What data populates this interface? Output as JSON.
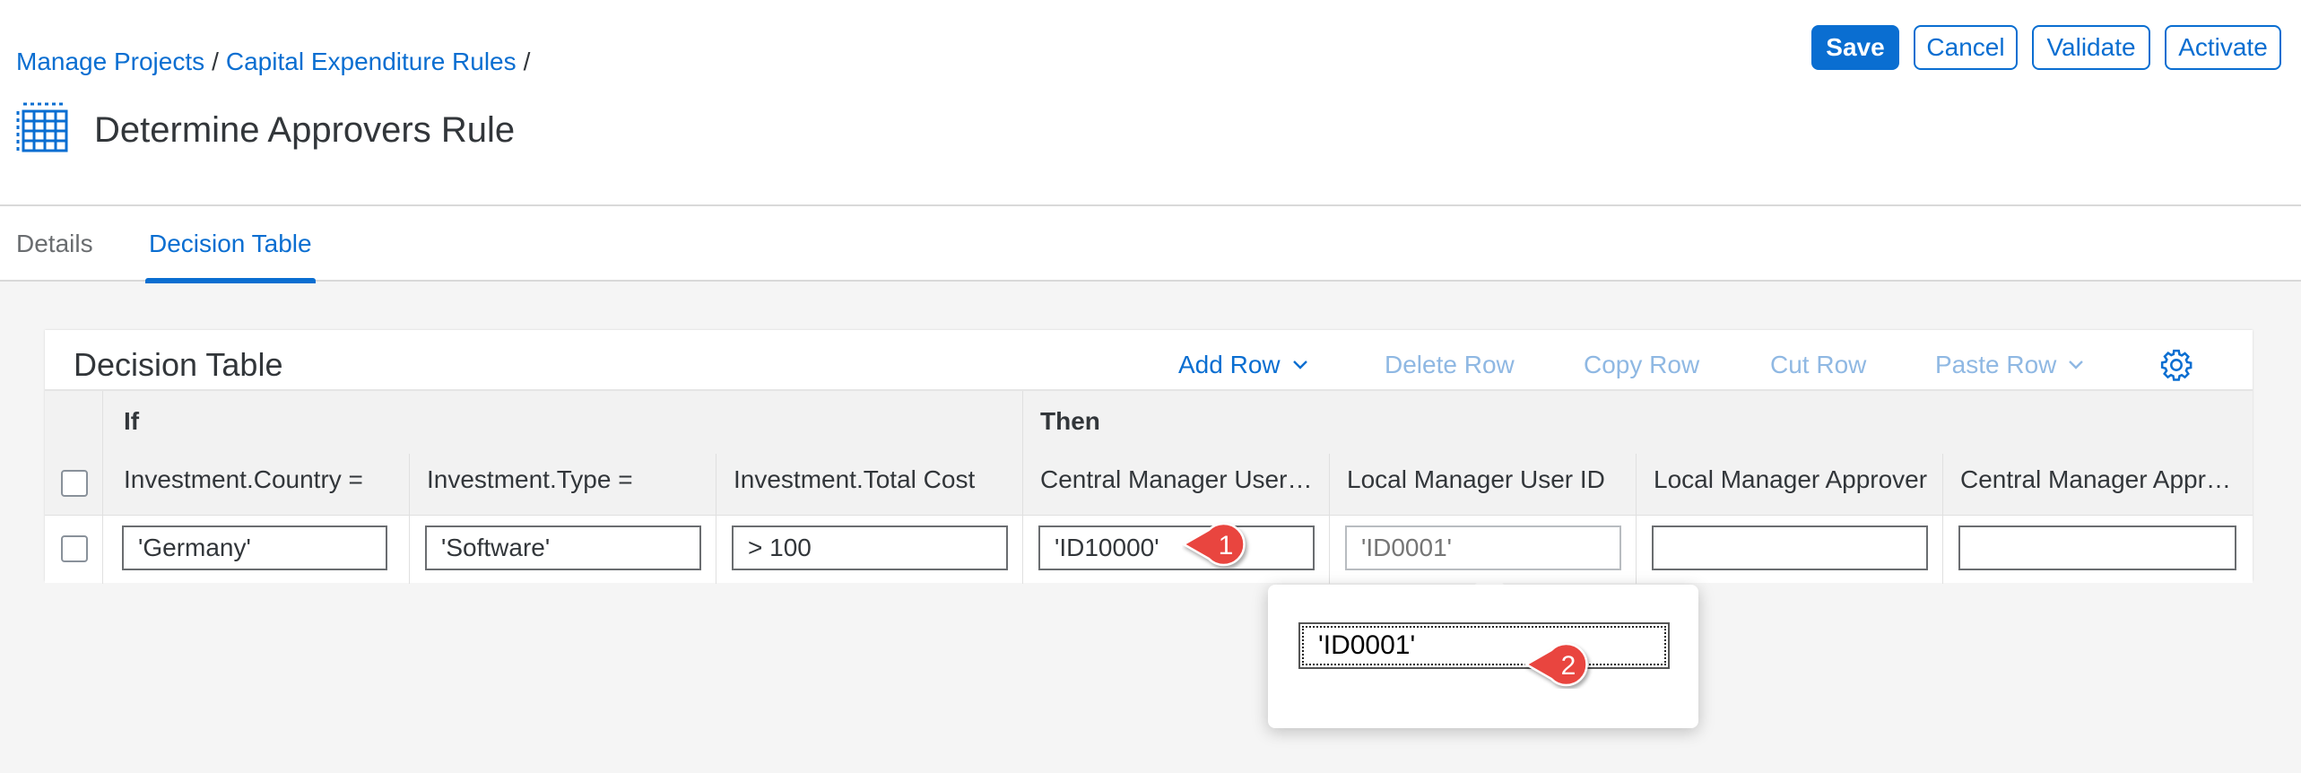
{
  "breadcrumb": {
    "items": [
      "Manage Projects",
      "Capital Expenditure Rules"
    ],
    "separator": "/"
  },
  "page": {
    "title": "Determine Approvers Rule",
    "icon": "table-grid-icon"
  },
  "header_actions": {
    "save": "Save",
    "cancel": "Cancel",
    "validate": "Validate",
    "activate": "Activate"
  },
  "tabs": [
    {
      "label": "Details",
      "active": false
    },
    {
      "label": "Decision Table",
      "active": true
    }
  ],
  "decision_table": {
    "title": "Decision Table",
    "toolbar": {
      "add_row": "Add Row",
      "delete_row": "Delete Row",
      "copy_row": "Copy Row",
      "cut_row": "Cut Row",
      "paste_row": "Paste Row",
      "settings_icon": "gear-icon"
    },
    "groups": {
      "if": "If",
      "then": "Then"
    },
    "columns": [
      "Investment.Country =",
      "Investment.Type =",
      "Investment.Total Cost",
      "Central Manager User ID",
      "Local Manager User ID",
      "Local Manager Approver",
      "Central Manager Approver"
    ],
    "rows": [
      {
        "cells": [
          "'Germany'",
          "'Software'",
          "> 100",
          "'ID10000'",
          "",
          "",
          ""
        ]
      }
    ],
    "placeholders": [
      "",
      "",
      "",
      "",
      "'ID0001'",
      "",
      ""
    ]
  },
  "popover": {
    "value": "'ID0001'"
  },
  "callouts": [
    "1",
    "2"
  ],
  "colors": {
    "accent": "#0a6ed1",
    "callout": "#e9453f",
    "text": "#32363a"
  }
}
